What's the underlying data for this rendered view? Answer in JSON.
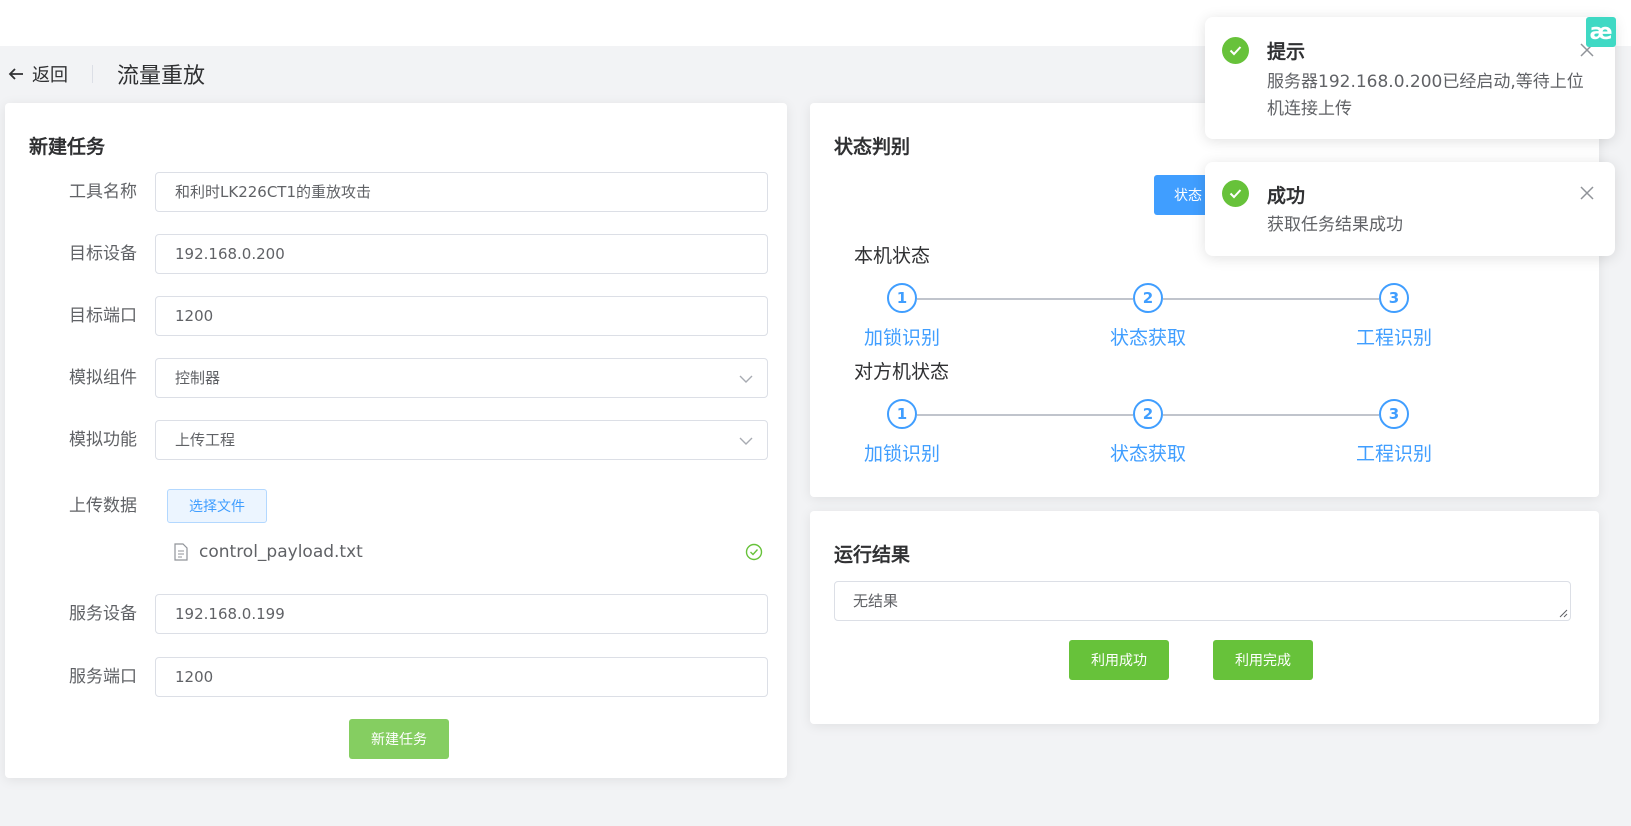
{
  "header": {
    "back_label": "返回",
    "page_title": "流量重放"
  },
  "new_task": {
    "title": "新建任务",
    "fields": [
      {
        "label": "工具名称",
        "value": "和利时LK226CT1的重放攻击"
      },
      {
        "label": "目标设备",
        "value": "192.168.0.200"
      },
      {
        "label": "目标端口",
        "value": "1200"
      },
      {
        "label": "模拟组件",
        "value": "控制器"
      },
      {
        "label": "模拟功能",
        "value": "上传工程"
      }
    ],
    "upload": {
      "label": "上传数据",
      "button": "选择文件",
      "file_name": "control_payload.txt"
    },
    "service_fields": [
      {
        "label": "服务设备",
        "value": "192.168.0.199"
      },
      {
        "label": "服务端口",
        "value": "1200"
      }
    ],
    "submit_label": "新建任务"
  },
  "status": {
    "title": "状态判别",
    "button_label": "状态",
    "local_label": "本机状态",
    "remote_label": "对方机状态",
    "local_steps": [
      {
        "num": "1",
        "title": "加锁识别"
      },
      {
        "num": "2",
        "title": "状态获取"
      },
      {
        "num": "3",
        "title": "工程识别"
      }
    ],
    "remote_steps": [
      {
        "num": "1",
        "title": "加锁识别"
      },
      {
        "num": "2",
        "title": "状态获取"
      },
      {
        "num": "3",
        "title": "工程识别"
      }
    ]
  },
  "result": {
    "title": "运行结果",
    "text": "无结果",
    "btn_success": "利用成功",
    "btn_done": "利用完成"
  },
  "notifications": [
    {
      "title": "提示",
      "message": "服务器192.168.0.200已经启动,等待上位机连接上传"
    },
    {
      "title": "成功",
      "message": "获取任务结果成功"
    }
  ],
  "corner_logo": "æ",
  "colors": {
    "primary": "#409eff",
    "success": "#67c23a",
    "background": "#f2f3f5"
  }
}
